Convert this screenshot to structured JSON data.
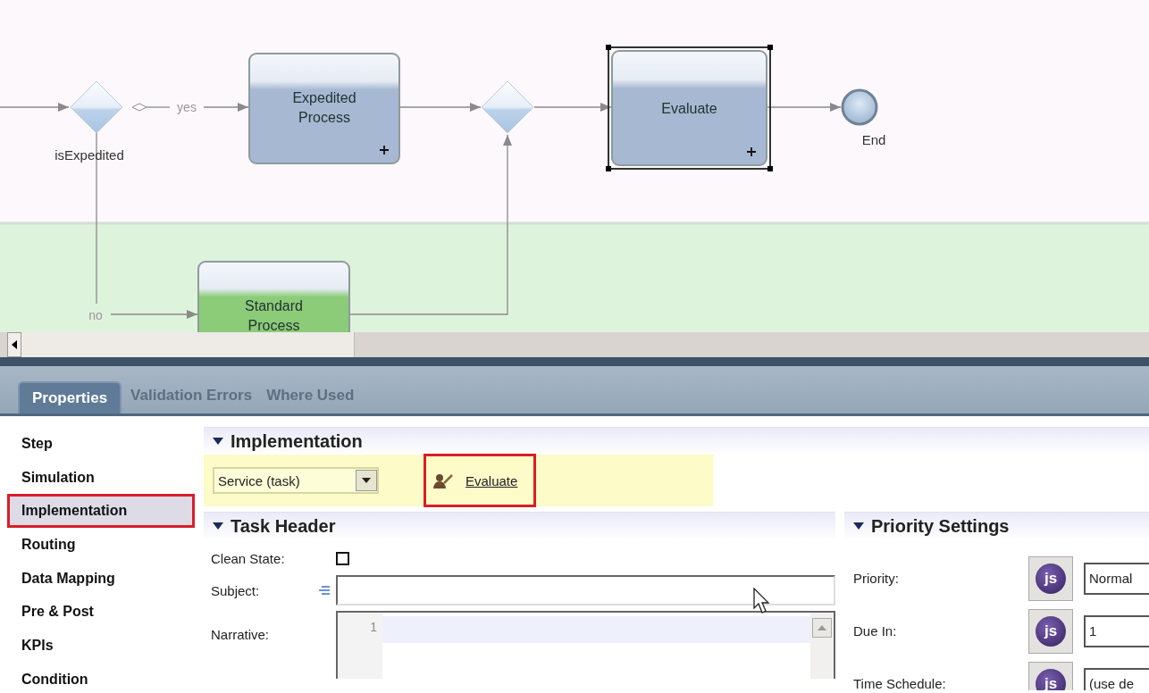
{
  "diagram": {
    "nodes": [
      {
        "kind": "gateway",
        "label": "isExpedited"
      },
      {
        "kind": "task",
        "label": "Expedited Process",
        "color": "#a7b8d2",
        "selected": false
      },
      {
        "kind": "gateway"
      },
      {
        "kind": "task",
        "label": "Evaluate",
        "color": "#a7b8d2",
        "selected": true
      },
      {
        "kind": "end",
        "label": "End"
      },
      {
        "kind": "task",
        "label": "Standard Process",
        "color": "#8ccb78",
        "selected": false
      }
    ],
    "flows": [
      {
        "label": "yes"
      },
      {
        "label": "no"
      }
    ]
  },
  "tabs": [
    {
      "label": "Properties",
      "selected": true
    },
    {
      "label": "Validation Errors",
      "selected": false
    },
    {
      "label": "Where Used",
      "selected": false
    }
  ],
  "sidebar": {
    "items": [
      {
        "label": "Step",
        "selected": false,
        "highlighted": false
      },
      {
        "label": "Simulation",
        "selected": false,
        "highlighted": false
      },
      {
        "label": "Implementation",
        "selected": true,
        "highlighted": true
      },
      {
        "label": "Routing",
        "selected": false,
        "highlighted": false
      },
      {
        "label": "Data Mapping",
        "selected": false,
        "highlighted": false
      },
      {
        "label": "Pre & Post",
        "selected": false,
        "highlighted": false
      },
      {
        "label": "KPIs",
        "selected": false,
        "highlighted": false
      },
      {
        "label": "Condition",
        "selected": false,
        "highlighted": false
      }
    ]
  },
  "implementation": {
    "title": "Implementation",
    "expanded": true,
    "type": "Service (task)",
    "link": {
      "label": "Evaluate",
      "highlighted": true
    }
  },
  "task_header": {
    "title": "Task Header",
    "expanded": true,
    "fields": [
      {
        "kind": "checkbox",
        "label": "Clean State:",
        "checked": false
      },
      {
        "kind": "text",
        "label": "Subject:"
      },
      {
        "kind": "editor",
        "label": "Narrative:",
        "line_numbers": [
          "1"
        ]
      }
    ]
  },
  "priority_settings": {
    "title": "Priority Settings",
    "expanded": true,
    "fields": [
      {
        "label": "Priority:",
        "script_button": "js",
        "value": "Normal"
      },
      {
        "label": "Due In:",
        "script_button": "js",
        "value": "1"
      },
      {
        "label": "Time Schedule:",
        "script_button": "js",
        "value": "(use de"
      }
    ]
  }
}
